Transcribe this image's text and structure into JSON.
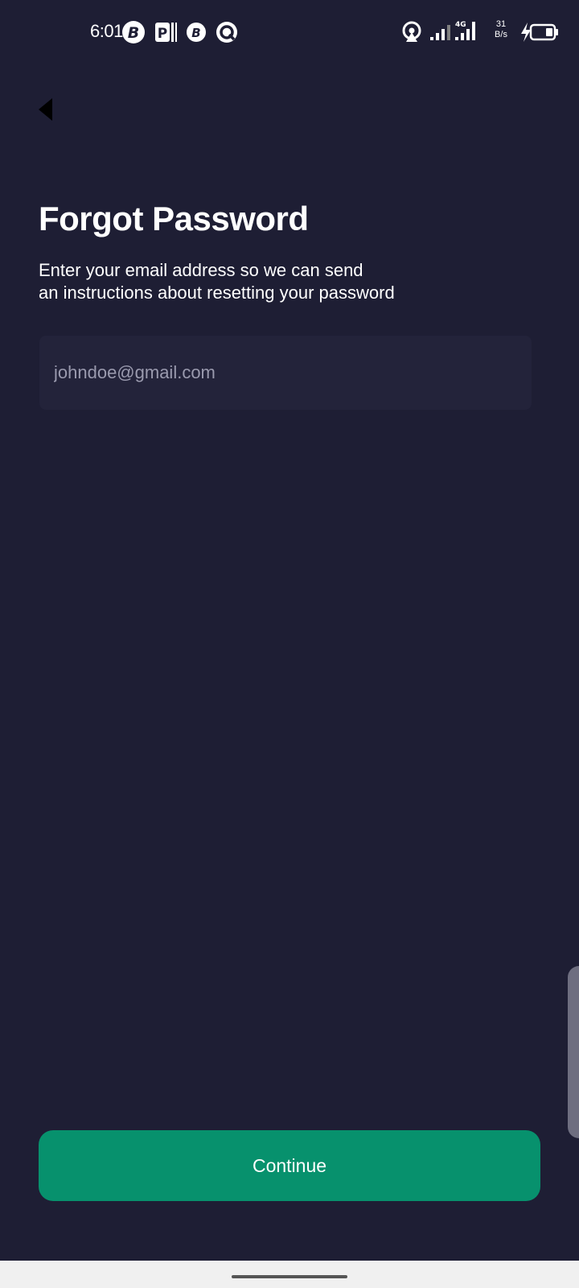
{
  "status_bar": {
    "time": "6:01",
    "net_speed_value": "31",
    "net_speed_unit": "B/s",
    "network_type": "4G",
    "left_icons": [
      "b-badge-icon",
      "parking-app-icon",
      "b-circle-icon",
      "q-circle-icon"
    ],
    "right_icons": [
      "hotspot-icon",
      "signal-icon",
      "signal-4g-icon",
      "charging-icon",
      "battery-icon"
    ]
  },
  "header": {
    "back_icon": "back-arrow-icon"
  },
  "content": {
    "title": "Forgot Password",
    "subtitle_line1": "Enter your email address so we can send",
    "subtitle_line2": "an instructions about resetting your password"
  },
  "email_field": {
    "placeholder": "johndoe@gmail.com",
    "value": ""
  },
  "continue_button": {
    "label": "Continue"
  },
  "colors": {
    "background": "#1e1e34",
    "input_background": "#23233a",
    "accent": "#07916d",
    "text": "#ffffff",
    "placeholder": "#9a9aae"
  }
}
